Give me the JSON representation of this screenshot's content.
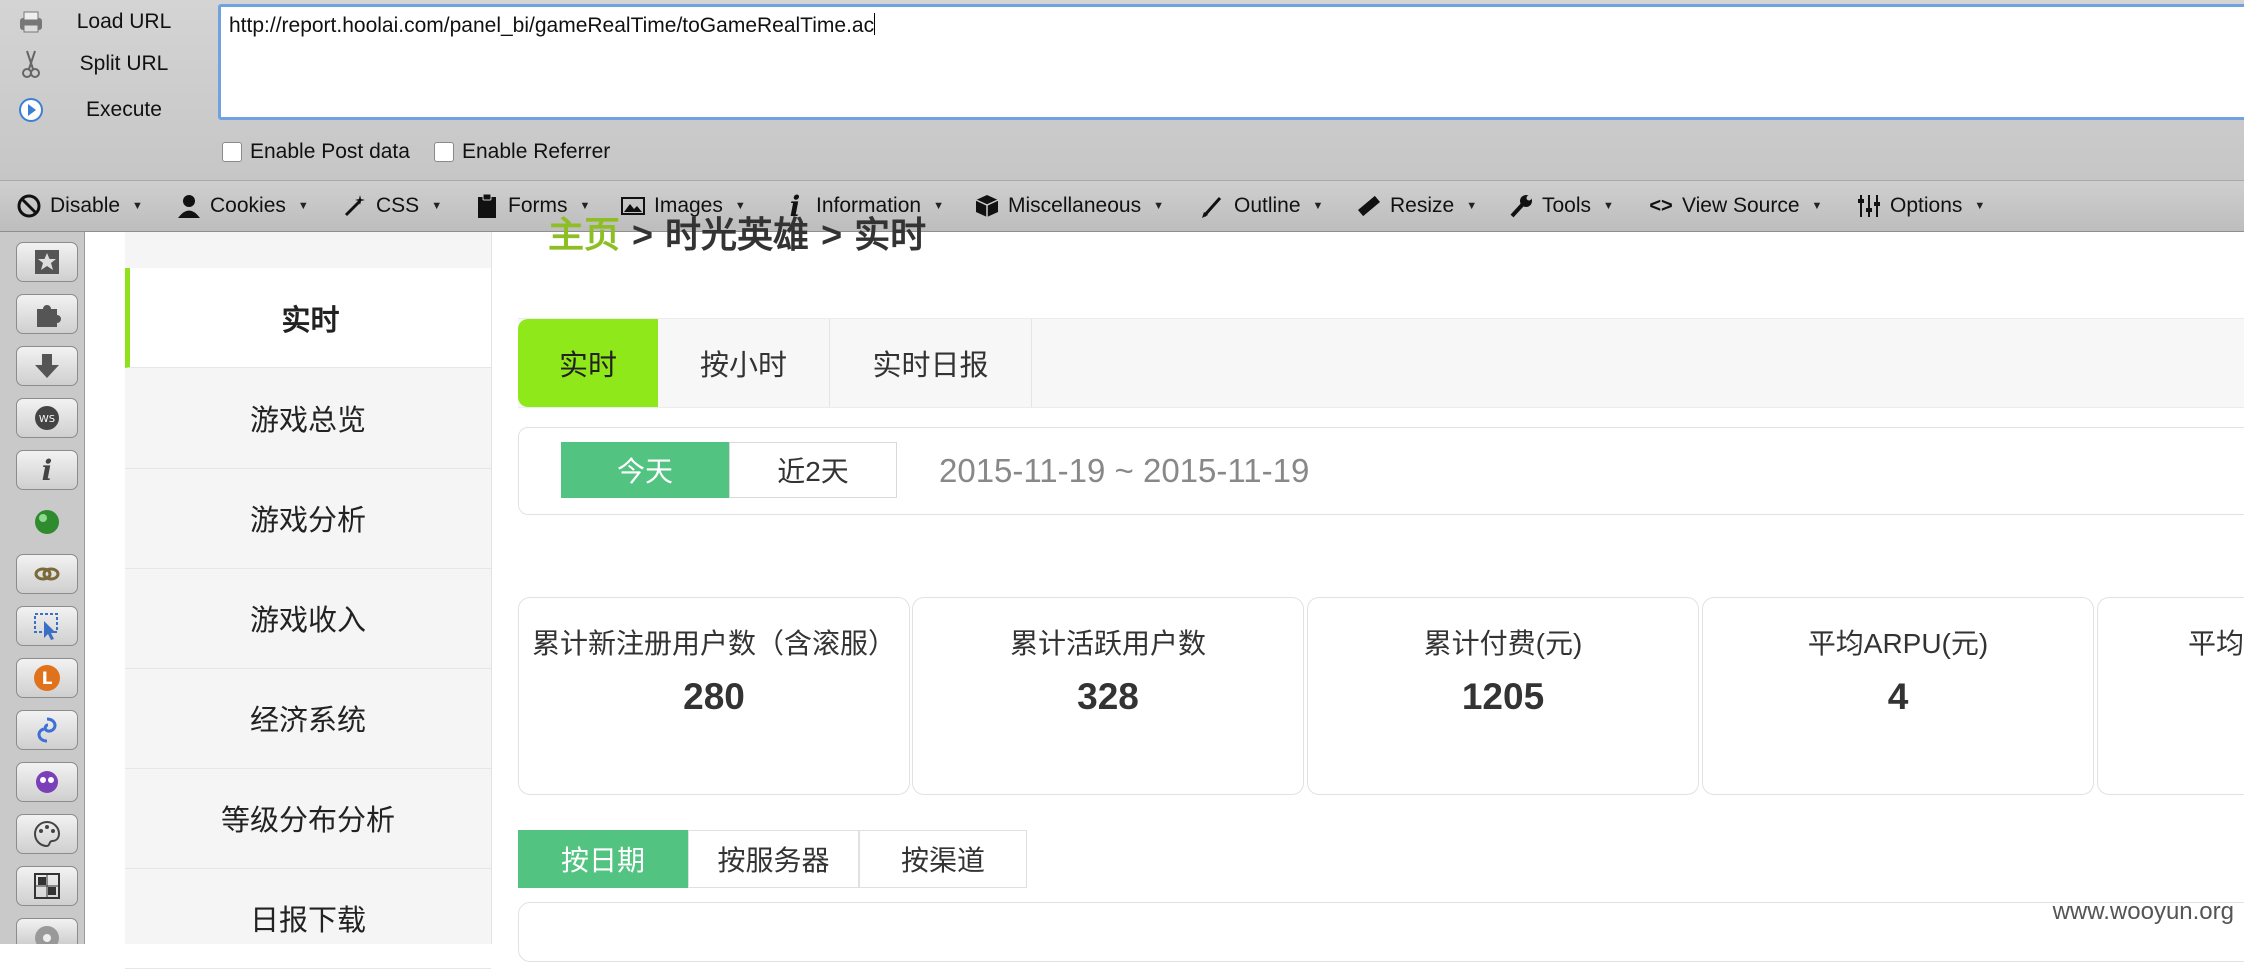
{
  "hackbar": {
    "load_url": "Load URL",
    "split_url": "Split URL",
    "execute": "Execute",
    "url_value": "http://report.hoolai.com/panel_bi/gameRealTime/toGameRealTime.ac",
    "enable_post": "Enable Post data",
    "enable_referrer": "Enable Referrer"
  },
  "webdev": {
    "items": [
      {
        "label": "Disable",
        "icon": "disable-icon"
      },
      {
        "label": "Cookies",
        "icon": "cookies-icon"
      },
      {
        "label": "CSS",
        "icon": "css-icon"
      },
      {
        "label": "Forms",
        "icon": "forms-icon"
      },
      {
        "label": "Images",
        "icon": "images-icon"
      },
      {
        "label": "Information",
        "icon": "information-icon"
      },
      {
        "label": "Miscellaneous",
        "icon": "miscellaneous-icon"
      },
      {
        "label": "Outline",
        "icon": "outline-icon"
      },
      {
        "label": "Resize",
        "icon": "resize-icon"
      },
      {
        "label": "Tools",
        "icon": "tools-icon"
      },
      {
        "label": "View Source",
        "icon": "view-source-icon"
      },
      {
        "label": "Options",
        "icon": "options-icon"
      }
    ]
  },
  "icon_strip": [
    "bookmark-star-icon",
    "addon-puzzle-icon",
    "download-arrow-icon",
    "ws-badge-icon",
    "info-i-icon",
    "green-globe-icon",
    "link-chain-icon",
    "cursor-select-icon",
    "orange-l-icon",
    "blue-swirl-icon",
    "purple-creature-icon",
    "palette-icon",
    "grid-icon",
    "disc-icon"
  ],
  "sidebar": {
    "items": [
      "实时",
      "游戏总览",
      "游戏分析",
      "游戏收入",
      "经济系统",
      "等级分布分析",
      "日报下载"
    ]
  },
  "breadcrumb": {
    "home": "主页",
    "game": "时光英雄",
    "current": "实时",
    "separator": ">"
  },
  "main_tabs": [
    "实时",
    "按小时",
    "实时日报"
  ],
  "date_filter": {
    "today": "今天",
    "last2": "近2天",
    "range": "2015-11-19 ~ 2015-11-19"
  },
  "stats": [
    {
      "title": "累计新注册用户数（含滚服）",
      "value": "280"
    },
    {
      "title": "累计活跃用户数",
      "value": "328"
    },
    {
      "title": "累计付费(元)",
      "value": "1205"
    },
    {
      "title": "平均ARPU(元)",
      "value": "4"
    },
    {
      "title": "平均",
      "value": ""
    }
  ],
  "sub_tabs": [
    "按日期",
    "按服务器",
    "按渠道"
  ],
  "watermark": "www.wooyun.org",
  "colors": {
    "accent_green": "#8fe81a",
    "button_green": "#52c381",
    "home_link": "#8dbf24"
  }
}
